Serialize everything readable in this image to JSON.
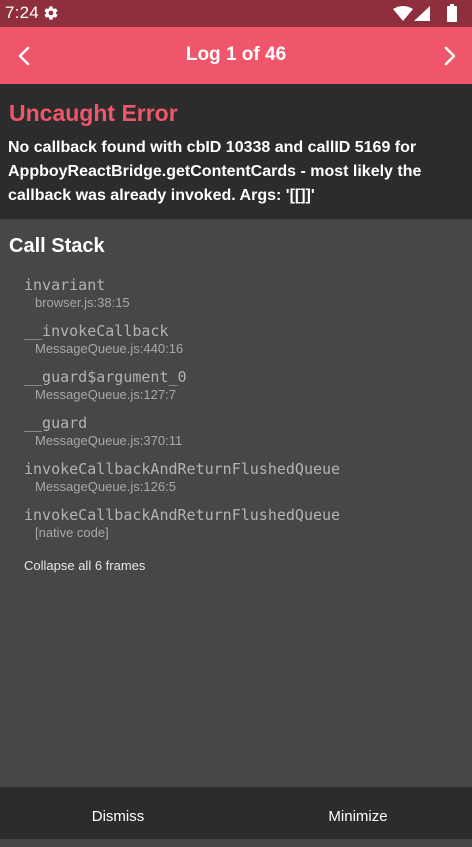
{
  "status_bar": {
    "time": "7:24",
    "icons": [
      "gear-icon",
      "wifi-icon",
      "signal-icon",
      "battery-icon"
    ]
  },
  "header": {
    "title": "Log 1 of 46",
    "prev_icon": "chevron-left-icon",
    "next_icon": "chevron-right-icon"
  },
  "error": {
    "title": "Uncaught Error",
    "message": "No callback found with cbID 10338 and callID 5169 for AppboyReactBridge.getContentCards - most likely the callback was already invoked. Args: '[[]]'"
  },
  "callstack": {
    "title": "Call Stack",
    "frames": [
      {
        "fn": "invariant",
        "loc": "browser.js:38:15"
      },
      {
        "fn": "__invokeCallback",
        "loc": "MessageQueue.js:440:16"
      },
      {
        "fn": "__guard$argument_0",
        "loc": "MessageQueue.js:127:7"
      },
      {
        "fn": "__guard",
        "loc": "MessageQueue.js:370:11"
      },
      {
        "fn": "invokeCallbackAndReturnFlushedQueue",
        "loc": "MessageQueue.js:126:5"
      },
      {
        "fn": "invokeCallbackAndReturnFlushedQueue",
        "loc": "[native code]"
      }
    ],
    "collapse_label": "Collapse all 6 frames"
  },
  "footer": {
    "dismiss_label": "Dismiss",
    "minimize_label": "Minimize"
  },
  "colors": {
    "status_bar": "#8f2f3d",
    "accent": "#f0566b",
    "dark_panel": "#2c2c2c",
    "body": "#474747"
  }
}
